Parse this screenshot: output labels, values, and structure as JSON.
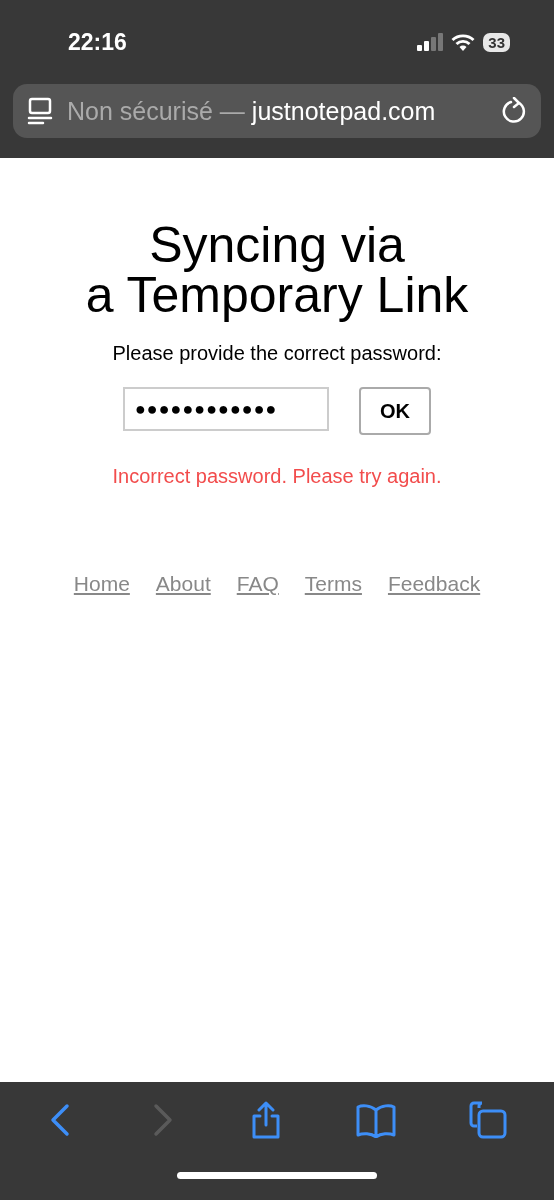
{
  "status_bar": {
    "time": "22:16",
    "battery": "33"
  },
  "address_bar": {
    "security": "Non sécurisé —",
    "domain": "justnotepad.com"
  },
  "page": {
    "title_lines": [
      "Syncing via",
      "a Temporary Link"
    ],
    "prompt": "Please provide the correct password:",
    "password_field": {
      "value": "●●●●●●●●●●●●"
    },
    "ok_button": "OK",
    "error": "Incorrect password. Please try again.",
    "footer_links": [
      "Home",
      "About",
      "FAQ",
      "Terms",
      "Feedback"
    ]
  },
  "toolbar": {
    "back_disabled": false,
    "forward_disabled": true
  }
}
